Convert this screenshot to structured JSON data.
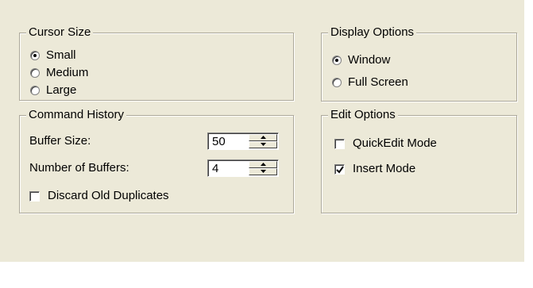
{
  "cursor_size": {
    "title": "Cursor Size",
    "options": [
      {
        "label": "Small",
        "selected": true
      },
      {
        "label": "Medium",
        "selected": false
      },
      {
        "label": "Large",
        "selected": false
      }
    ]
  },
  "display_options": {
    "title": "Display Options",
    "options": [
      {
        "label": "Window",
        "selected": true
      },
      {
        "label": "Full Screen",
        "selected": false
      }
    ]
  },
  "command_history": {
    "title": "Command History",
    "buffer_size_label": "Buffer Size:",
    "buffer_size_value": "50",
    "num_buffers_label": "Number of Buffers:",
    "num_buffers_value": "4",
    "discard_label": "Discard Old Duplicates",
    "discard_checked": false
  },
  "edit_options": {
    "title": "Edit Options",
    "quickedit_label": "QuickEdit Mode",
    "quickedit_checked": false,
    "insert_label": "Insert Mode",
    "insert_checked": true
  },
  "colors": {
    "panel_bg": "#ece9d8",
    "group_border": "#aca899"
  }
}
